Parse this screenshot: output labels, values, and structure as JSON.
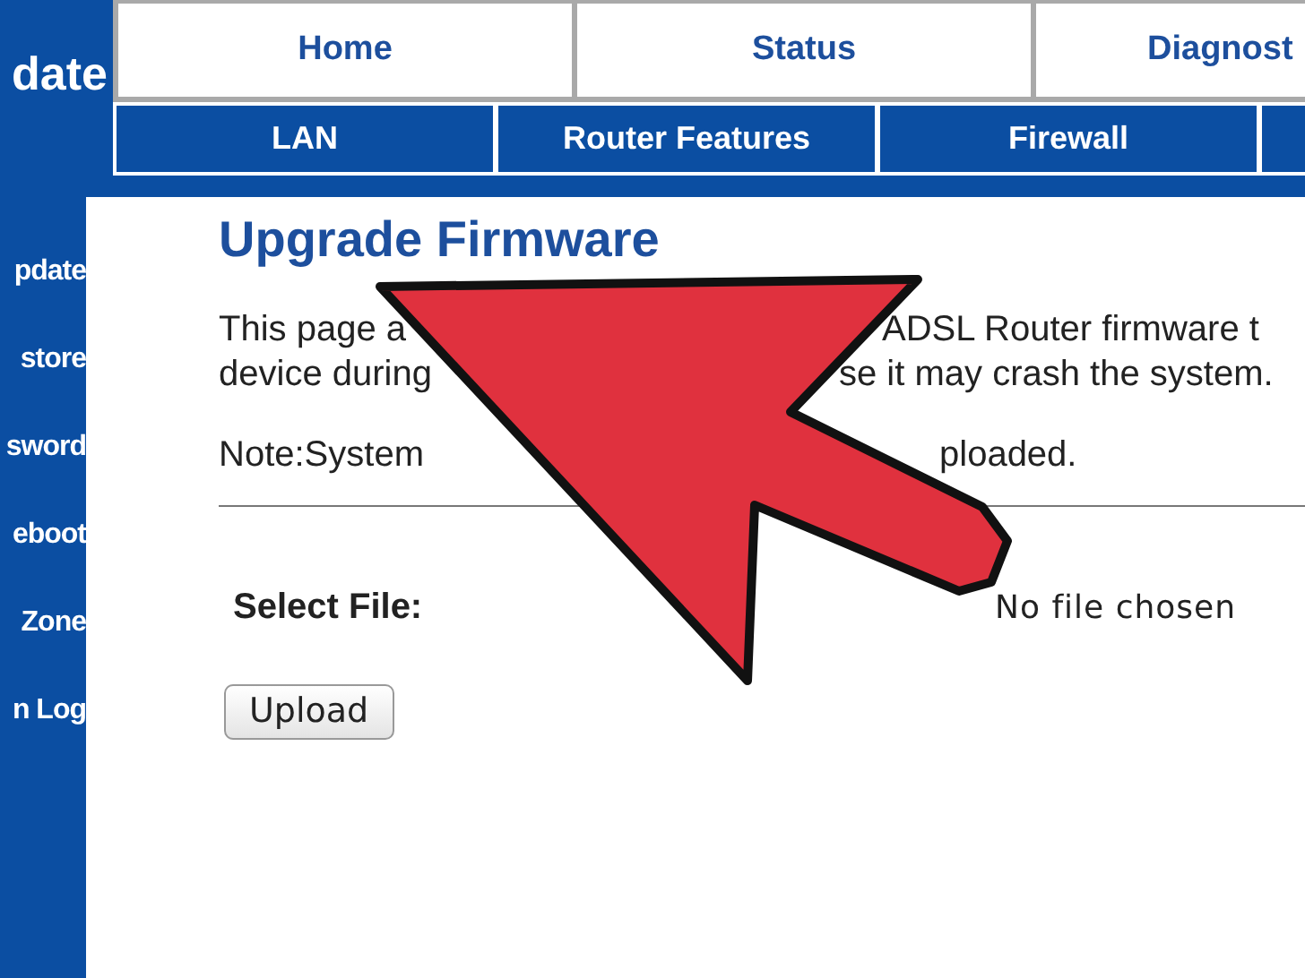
{
  "header": {
    "title_fragment": "date"
  },
  "top_nav": [
    {
      "label": "Home"
    },
    {
      "label": "Status"
    },
    {
      "label": "Diagnost"
    }
  ],
  "sub_nav": [
    {
      "label": "LAN"
    },
    {
      "label": "Router Features"
    },
    {
      "label": "Firewall"
    }
  ],
  "sidebar": {
    "items": [
      {
        "label": "pdate"
      },
      {
        "label": "store"
      },
      {
        "label": "sword"
      },
      {
        "label": "eboot"
      },
      {
        "label": "Zone"
      },
      {
        "label": "n Log"
      }
    ]
  },
  "page": {
    "title": "Upgrade Firmware",
    "lines": [
      {
        "left": "This page a",
        "right": "ADSL Router firmware t"
      },
      {
        "left": "device during",
        "right": "se it may crash the system."
      },
      {
        "left": "Note:System",
        "right": "ploaded."
      }
    ],
    "select_file": {
      "label": "Select File:",
      "status": "No file chosen"
    },
    "upload_button": "Upload"
  }
}
